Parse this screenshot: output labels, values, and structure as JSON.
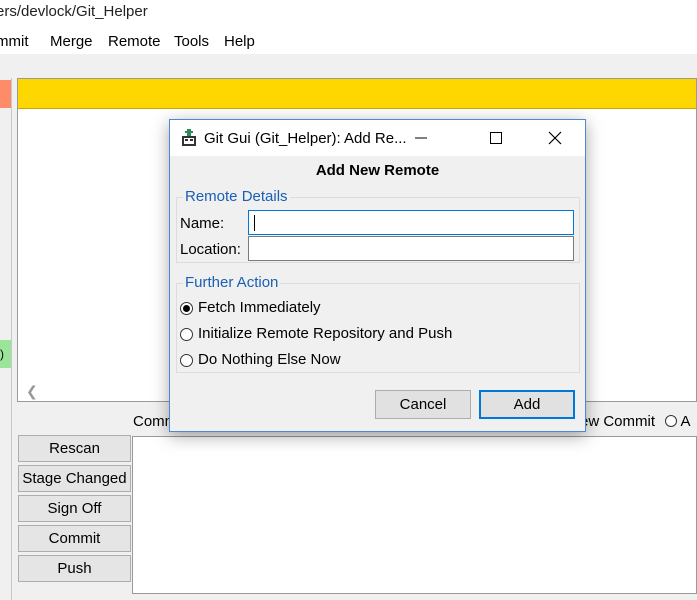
{
  "window": {
    "title": "ers/devlock/Git_Helper"
  },
  "menu": [
    {
      "label": "mmit"
    },
    {
      "label": "Merge"
    },
    {
      "label": "Remote"
    },
    {
      "label": "Tools"
    },
    {
      "label": "Help"
    }
  ],
  "status_strip": {
    "green_text": ")"
  },
  "commit_area": {
    "label": "Commit Message:",
    "new_commit_label": "ew Commit",
    "amend_partial": "A"
  },
  "side_buttons": [
    {
      "label": "Rescan"
    },
    {
      "label": "Stage Changed"
    },
    {
      "label": "Sign Off"
    },
    {
      "label": "Commit"
    },
    {
      "label": "Push"
    }
  ],
  "dialog": {
    "title": "Git Gui (Git_Helper): Add Re...",
    "heading": "Add New Remote",
    "remote_details": {
      "legend": "Remote Details",
      "name_label": "Name:",
      "name_value": "",
      "location_label": "Location:",
      "location_value": ""
    },
    "further_action": {
      "legend": "Further Action",
      "options": [
        {
          "label": "Fetch Immediately",
          "checked": true
        },
        {
          "label": "Initialize Remote Repository and Push",
          "checked": false
        },
        {
          "label": "Do Nothing Else Now",
          "checked": false
        }
      ]
    },
    "buttons": {
      "cancel": "Cancel",
      "add": "Add"
    }
  },
  "colors": {
    "diff_header": "#ffd700",
    "accent": "#0078d7",
    "legend_text": "#1a5fb4",
    "strip_red": "#ff8c69",
    "strip_green": "#9be59b"
  }
}
